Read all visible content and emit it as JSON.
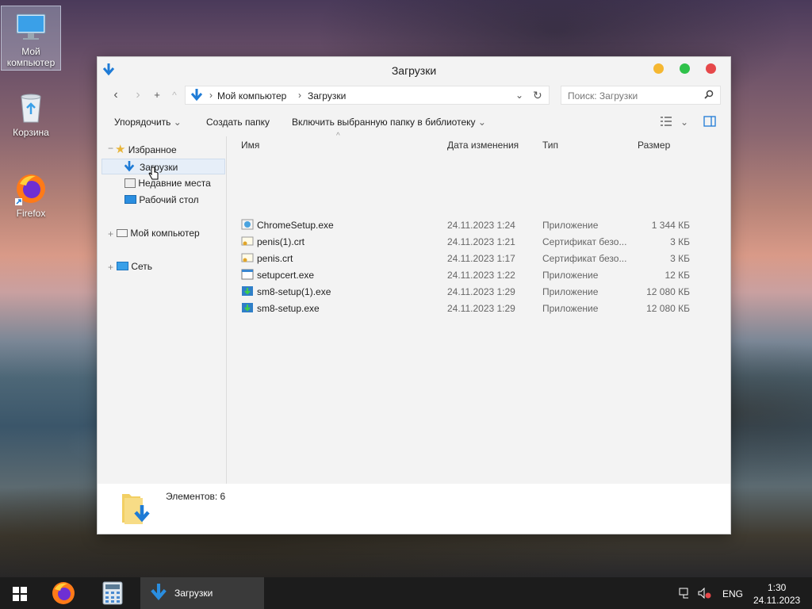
{
  "desktop": {
    "icons": [
      {
        "label_line1": "Мой",
        "label_line2": "компьютер",
        "icon": "monitor-icon"
      },
      {
        "label": "Корзина",
        "icon": "recycle-bin-icon"
      },
      {
        "label": "Firefox",
        "icon": "firefox-icon"
      }
    ]
  },
  "window": {
    "title": "Загрузки",
    "address": {
      "root": "Мой компьютер",
      "current": "Загрузки"
    },
    "search_placeholder": "Поиск: Загрузки",
    "toolbar": {
      "organize": "Упорядочить",
      "new_folder": "Создать папку",
      "include_library": "Включить выбранную папку в библиотеку"
    },
    "sidebar": {
      "favorites": "Избранное",
      "downloads": "Загрузки",
      "recent": "Недавние места",
      "desktop": "Рабочий стол",
      "computer": "Мой компьютер",
      "network": "Сеть"
    },
    "columns": {
      "name": "Имя",
      "date": "Дата изменения",
      "type": "Тип",
      "size": "Размер"
    },
    "files": [
      {
        "name": "ChromeSetup.exe",
        "date": "24.11.2023 1:24",
        "type": "Приложение",
        "size": "1 344 КБ"
      },
      {
        "name": "penis(1).crt",
        "date": "24.11.2023 1:21",
        "type": "Сертификат безо...",
        "size": "3 КБ"
      },
      {
        "name": "penis.crt",
        "date": "24.11.2023 1:17",
        "type": "Сертификат безо...",
        "size": "3 КБ"
      },
      {
        "name": "setupcert.exe",
        "date": "24.11.2023 1:22",
        "type": "Приложение",
        "size": "12 КБ"
      },
      {
        "name": "sm8-setup(1).exe",
        "date": "24.11.2023 1:29",
        "type": "Приложение",
        "size": "12 080 КБ"
      },
      {
        "name": "sm8-setup.exe",
        "date": "24.11.2023 1:29",
        "type": "Приложение",
        "size": "12 080 КБ"
      }
    ],
    "status": "Элементов: 6"
  },
  "taskbar": {
    "task_label": "Загрузки",
    "lang": "ENG",
    "time": "1:30",
    "date": "24.11.2023"
  },
  "colors": {
    "accent": "#1e7bd6",
    "close": "#e6484a",
    "minimize": "#f5b731",
    "maximize": "#2fc24a"
  }
}
